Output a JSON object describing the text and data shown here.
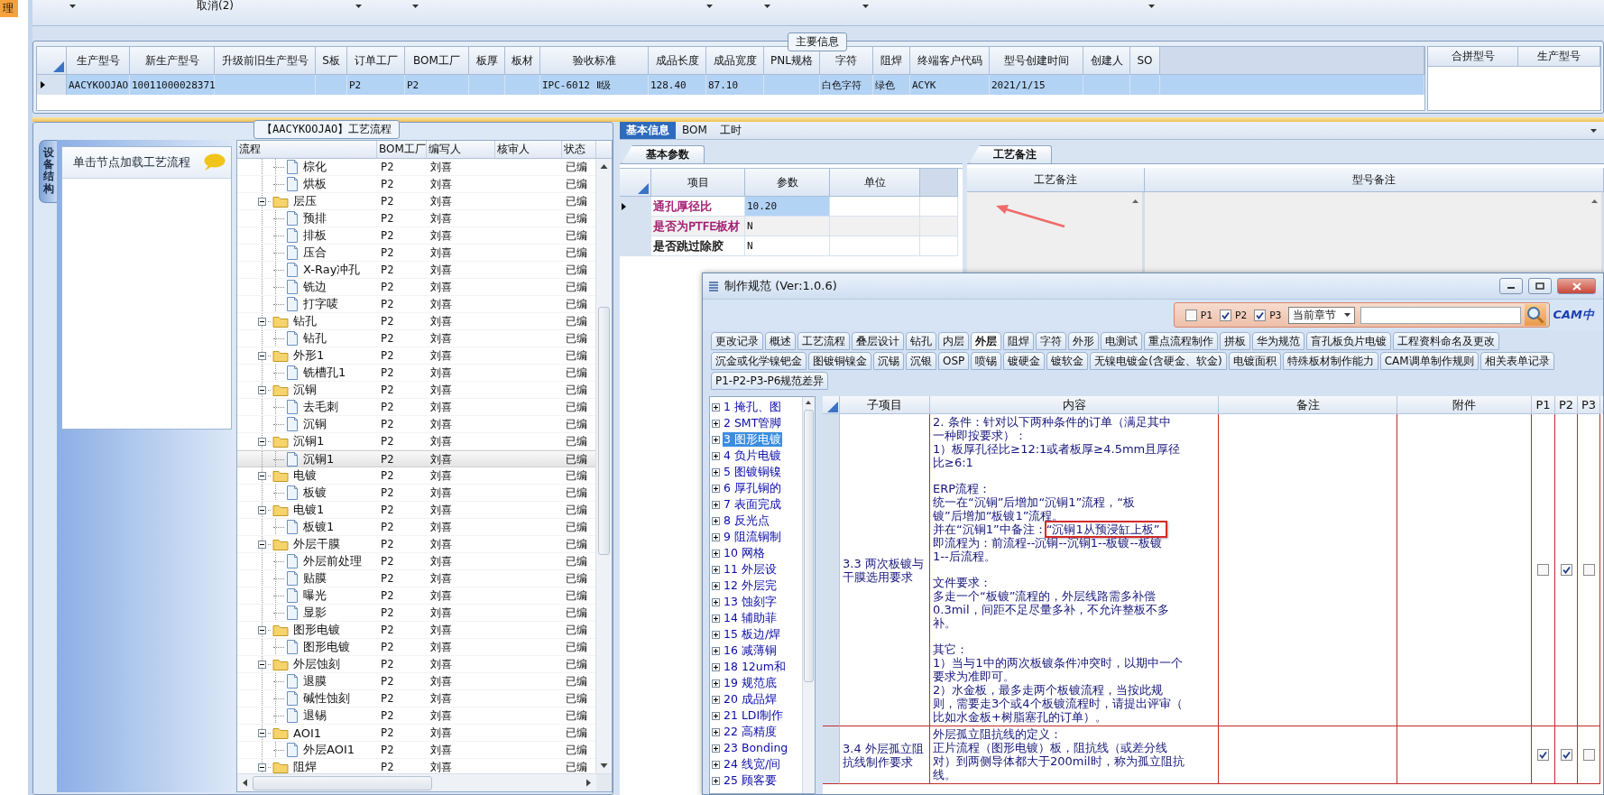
{
  "nav_strip": {
    "items": [
      {
        "label": "理",
        "selected": true
      }
    ]
  },
  "toolbar": {
    "buttons": [
      {
        "label": "取消(2)"
      }
    ]
  },
  "main_info": {
    "title": "主要信息",
    "columns": [
      "生产型号",
      "新生产型号",
      "升级前旧生产型号",
      "S板",
      "订单工厂",
      "BOM工厂",
      "板厚",
      "板材",
      "验收标准",
      "成品长度",
      "成品宽度",
      "PNL规格",
      "字符",
      "阻焊",
      "终端客户代码",
      "型号创建时间",
      "创建人",
      "SO"
    ],
    "rows": [
      {
        "selected": true,
        "cells": [
          "AACYKOOJAO",
          "10011000028371",
          null,
          null,
          "P2",
          "P2",
          null,
          null,
          "IPC-6012 Ⅱ级",
          "128.40",
          "87.10",
          null,
          "白色字符",
          "绿色",
          "ACYK",
          "2021/1/15",
          null,
          null
        ]
      }
    ]
  },
  "merge_table": {
    "columns": [
      "合拼型号",
      "生产型号"
    ]
  },
  "process_panel": {
    "title": "【AACYKOOJAO】工艺流程",
    "side_tab": "设备结构",
    "hint": "单击节点加载工艺流程",
    "tree": {
      "columns": [
        "流程",
        "BOM工厂",
        "编写人",
        "核审人",
        "状态"
      ],
      "rows": [
        {
          "kind": "continued",
          "children": [
            {
              "kind": "file",
              "label": "棕化",
              "bom": "P2",
              "writer": "刘喜",
              "status": "已编",
              "selected": false
            },
            {
              "kind": "file",
              "label": "烘板",
              "bom": "P2",
              "writer": "刘喜",
              "status": "已编",
              "selected": false
            }
          ]
        },
        {
          "kind": "folder",
          "label": "层压",
          "bom": "P2",
          "writer": "刘喜",
          "status": "已编",
          "selected": false,
          "expanded": true,
          "children": [
            {
              "kind": "file",
              "label": "预排",
              "bom": "P2",
              "writer": "刘喜",
              "status": "已编",
              "selected": false
            },
            {
              "kind": "file",
              "label": "排板",
              "bom": "P2",
              "writer": "刘喜",
              "status": "已编",
              "selected": false
            },
            {
              "kind": "file",
              "label": "压合",
              "bom": "P2",
              "writer": "刘喜",
              "status": "已编",
              "selected": false
            },
            {
              "kind": "file",
              "label": "X-Ray冲孔",
              "bom": "P2",
              "writer": "刘喜",
              "status": "已编",
              "selected": false
            },
            {
              "kind": "file",
              "label": "铣边",
              "bom": "P2",
              "writer": "刘喜",
              "status": "已编",
              "selected": false
            },
            {
              "kind": "file",
              "label": "打字唛",
              "bom": "P2",
              "writer": "刘喜",
              "status": "已编",
              "selected": false
            }
          ]
        },
        {
          "kind": "folder",
          "label": "钻孔",
          "bom": "P2",
          "writer": "刘喜",
          "status": "已编",
          "selected": false,
          "expanded": true,
          "children": [
            {
              "kind": "file",
              "label": "钻孔",
              "bom": "P2",
              "writer": "刘喜",
              "status": "已编",
              "selected": false
            }
          ]
        },
        {
          "kind": "folder",
          "label": "外形1",
          "bom": "P2",
          "writer": "刘喜",
          "status": "已编",
          "selected": false,
          "expanded": true,
          "children": [
            {
              "kind": "file",
              "label": "铣槽孔1",
              "bom": "P2",
              "writer": "刘喜",
              "status": "已编",
              "selected": false
            }
          ]
        },
        {
          "kind": "folder",
          "label": "沉铜",
          "bom": "P2",
          "writer": "刘喜",
          "status": "已编",
          "selected": false,
          "expanded": true,
          "children": [
            {
              "kind": "file",
              "label": "去毛刺",
              "bom": "P2",
              "writer": "刘喜",
              "status": "已编",
              "selected": false
            },
            {
              "kind": "file",
              "label": "沉铜",
              "bom": "P2",
              "writer": "刘喜",
              "status": "已编",
              "selected": false
            }
          ]
        },
        {
          "kind": "folder",
          "label": "沉铜1",
          "bom": "P2",
          "writer": "刘喜",
          "status": "已编",
          "selected": false,
          "expanded": true,
          "children": [
            {
              "kind": "file",
              "label": "沉铜1",
              "bom": "P2",
              "writer": "刘喜",
              "status": "已编",
              "selected": true
            }
          ]
        },
        {
          "kind": "folder",
          "label": "电镀",
          "bom": "P2",
          "writer": "刘喜",
          "status": "已编",
          "selected": false,
          "expanded": true,
          "children": [
            {
              "kind": "file",
              "label": "板镀",
              "bom": "P2",
              "writer": "刘喜",
              "status": "已编",
              "selected": false
            }
          ]
        },
        {
          "kind": "folder",
          "label": "电镀1",
          "bom": "P2",
          "writer": "刘喜",
          "status": "已编",
          "selected": false,
          "expanded": true,
          "children": [
            {
              "kind": "file",
              "label": "板镀1",
              "bom": "P2",
              "writer": "刘喜",
              "status": "已编",
              "selected": false
            }
          ]
        },
        {
          "kind": "folder",
          "label": "外层干膜",
          "bom": "P2",
          "writer": "刘喜",
          "status": "已编",
          "selected": false,
          "expanded": true,
          "children": [
            {
              "kind": "file",
              "label": "外层前处理",
              "bom": "P2",
              "writer": "刘喜",
              "status": "已编",
              "selected": false
            },
            {
              "kind": "file",
              "label": "贴膜",
              "bom": "P2",
              "writer": "刘喜",
              "status": "已编",
              "selected": false
            },
            {
              "kind": "file",
              "label": "曝光",
              "bom": "P2",
              "writer": "刘喜",
              "status": "已编",
              "selected": false
            },
            {
              "kind": "file",
              "label": "显影",
              "bom": "P2",
              "writer": "刘喜",
              "status": "已编",
              "selected": false
            }
          ]
        },
        {
          "kind": "folder",
          "label": "图形电镀",
          "bom": "P2",
          "writer": "刘喜",
          "status": "已编",
          "selected": false,
          "expanded": true,
          "children": [
            {
              "kind": "file",
              "label": "图形电镀",
              "bom": "P2",
              "writer": "刘喜",
              "status": "已编",
              "selected": false
            }
          ]
        },
        {
          "kind": "folder",
          "label": "外层蚀刻",
          "bom": "P2",
          "writer": "刘喜",
          "status": "已编",
          "selected": false,
          "expanded": true,
          "children": [
            {
              "kind": "file",
              "label": "退膜",
              "bom": "P2",
              "writer": "刘喜",
              "status": "已编",
              "selected": false
            },
            {
              "kind": "file",
              "label": "碱性蚀刻",
              "bom": "P2",
              "writer": "刘喜",
              "status": "已编",
              "selected": false
            },
            {
              "kind": "file",
              "label": "退锡",
              "bom": "P2",
              "writer": "刘喜",
              "status": "已编",
              "selected": false
            }
          ]
        },
        {
          "kind": "folder",
          "label": "AOI1",
          "bom": "P2",
          "writer": "刘喜",
          "status": "已编",
          "selected": false,
          "expanded": true,
          "children": [
            {
              "kind": "file",
              "label": "外层AOI1",
              "bom": "P2",
              "writer": "刘喜",
              "status": "已编",
              "selected": false
            }
          ]
        },
        {
          "kind": "folder",
          "label": "阻焊",
          "bom": "P2",
          "writer": "刘喜",
          "status": "已编",
          "selected": false,
          "expanded": true
        }
      ]
    }
  },
  "details": {
    "tabs": [
      {
        "label": "基本信息",
        "selected": true
      },
      {
        "label": "BOM",
        "selected": false
      },
      {
        "label": "工时",
        "selected": false
      }
    ],
    "params": {
      "title": "基本参数",
      "columns": [
        "项目",
        "参数",
        "单位"
      ],
      "rows": [
        {
          "item": "通孔厚径比",
          "value": "10.20",
          "selected": true,
          "color": "#a0186e"
        },
        {
          "item": "是否为PTFE板材",
          "value": "N",
          "selected": false,
          "color": "#a0186e"
        },
        {
          "item": "是否跳过除胶",
          "value": "N",
          "selected": false,
          "color": "#111111"
        }
      ]
    },
    "remarks": {
      "title": "工艺备注",
      "columns": [
        "工艺备注",
        "型号备注"
      ]
    }
  },
  "dialog": {
    "title": "制作规范 (Ver:1.0.6)",
    "filters": [
      {
        "label": "P1",
        "checked": false
      },
      {
        "label": "P2",
        "checked": true
      },
      {
        "label": "P3",
        "checked": true
      }
    ],
    "scope": "当前章节",
    "logo": "CAM中",
    "tab_rows": [
      [
        {
          "label": "更改记录",
          "selected": false
        },
        {
          "label": "概述",
          "selected": false
        },
        {
          "label": "工艺流程",
          "selected": false
        },
        {
          "label": "叠层设计",
          "selected": false
        },
        {
          "label": "钻孔",
          "selected": false
        },
        {
          "label": "内层",
          "selected": false
        },
        {
          "label": "外层",
          "selected": true
        },
        {
          "label": "阻焊",
          "selected": false
        },
        {
          "label": "字符",
          "selected": false
        },
        {
          "label": "外形",
          "selected": false
        },
        {
          "label": "电测试",
          "selected": false
        },
        {
          "label": "重点流程制作",
          "selected": false
        },
        {
          "label": "拼板",
          "selected": false
        },
        {
          "label": "华为规范",
          "selected": false
        },
        {
          "label": "盲孔板负片电镀",
          "selected": false
        },
        {
          "label": "工程资料命名及更改",
          "selected": false
        }
      ],
      [
        {
          "label": "沉金或化学镍钯金",
          "selected": false
        },
        {
          "label": "图镀铜镍金",
          "selected": false
        },
        {
          "label": "沉锡",
          "selected": false
        },
        {
          "label": "沉银",
          "selected": false
        },
        {
          "label": "OSP",
          "selected": false
        },
        {
          "label": "喷锡",
          "selected": false
        },
        {
          "label": "镀硬金",
          "selected": false
        },
        {
          "label": "镀软金",
          "selected": false
        },
        {
          "label": "无镍电镀金(含硬金、软金)",
          "selected": false
        },
        {
          "label": "电镀面积",
          "selected": false
        },
        {
          "label": "特殊板材制作能力",
          "selected": false
        },
        {
          "label": "CAM调单制作规则",
          "selected": false
        },
        {
          "label": "相关表单记录",
          "selected": false
        }
      ],
      [
        {
          "label": "P1-P2-P3-P6规范差异",
          "selected": false
        }
      ]
    ],
    "chapters": [
      {
        "label": "1 掩孔、图",
        "selected": false
      },
      {
        "label": "2 SMT管脚",
        "selected": false
      },
      {
        "label": "3 图形电镀",
        "selected": true
      },
      {
        "label": "4 负片电镀",
        "selected": false
      },
      {
        "label": "5 图镀铜镍",
        "selected": false
      },
      {
        "label": "6 厚孔铜的",
        "selected": false
      },
      {
        "label": "7 表面完成",
        "selected": false
      },
      {
        "label": "8 反光点",
        "selected": false
      },
      {
        "label": "9 阻流铜制",
        "selected": false
      },
      {
        "label": "10 网格",
        "selected": false
      },
      {
        "label": "11 外层设",
        "selected": false
      },
      {
        "label": "12 外层完",
        "selected": false
      },
      {
        "label": "13 蚀刻字",
        "selected": false
      },
      {
        "label": "14 辅助菲",
        "selected": false
      },
      {
        "label": "15 板边/焊",
        "selected": false
      },
      {
        "label": "16 减薄铜",
        "selected": false
      },
      {
        "label": "18 12um和",
        "selected": false
      },
      {
        "label": "19 规范底",
        "selected": false
      },
      {
        "label": "20 成品焊",
        "selected": false
      },
      {
        "label": "21 LDI制作",
        "selected": false
      },
      {
        "label": "22 高精度",
        "selected": false
      },
      {
        "label": "23 Bonding",
        "selected": false
      },
      {
        "label": "24 线宽/间",
        "selected": false
      },
      {
        "label": "25 顾客要",
        "selected": false
      }
    ],
    "table": {
      "columns": [
        "子项目",
        "内容",
        "备注",
        "附件",
        "P1",
        "P2",
        "P3"
      ],
      "rows": [
        {
          "item": "3.3 两次板镀与干膜选用要求",
          "p1": false,
          "p2": true,
          "p3": false,
          "blocks": [
            [
              "2. 条件：针对以下两种条件的订单（满足其中",
              "一种即按要求）：",
              "1）板厚孔径比≥12:1或者板厚≥4.5mm且厚径",
              "比≥6:1"
            ],
            [
              "ERP流程：",
              "统一在“沉铜”后增加“沉铜1”流程，“板",
              "镀”后增加“板镀1”流程。",
              {
                "text": "并在“沉铜1”中备注：",
                "marked": "“沉铜1从预浸缸上板”"
              },
              "即流程为：前流程--沉铜--沉铜1--板镀--板镀",
              "1--后流程。"
            ],
            [
              "文件要求：",
              "多走一个“板镀”流程的，外层线路需多补偿",
              "0.3mil，间距不足尽量多补，不允许整板不多",
              "补。"
            ],
            [
              "其它：",
              "1）当与1中的两次板镀条件冲突时，以期中一个",
              "要求为准即可。",
              "2）水金板，最多走两个板镀流程，当按此规",
              "则，需要走3个或4个板镀流程时，请提出评审（",
              "比如水金板+树脂塞孔的订单）。"
            ]
          ]
        },
        {
          "item": "3.4 外层孤立阻抗线制作要求",
          "p1": true,
          "p2": true,
          "p3": false,
          "blocks": [
            [
              "外层孤立阻抗线的定义：",
              "正片流程（图形电镀）板，阻抗线（或差分线",
              "对）到两侧导体都大于200mil时，称为孤立阻抗",
              "线。"
            ]
          ]
        }
      ]
    }
  }
}
